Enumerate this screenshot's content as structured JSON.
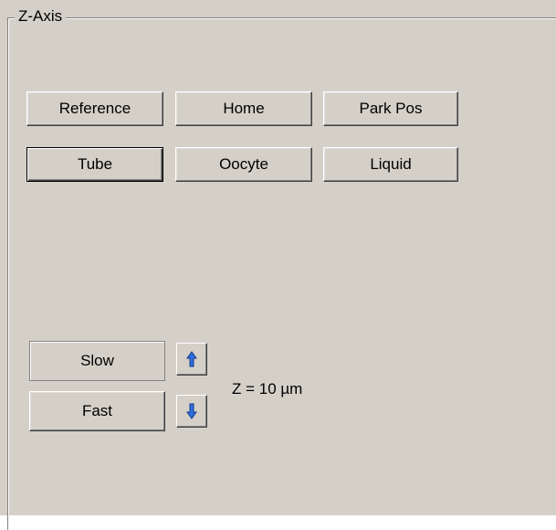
{
  "group": {
    "title": "Z-Axis"
  },
  "position_buttons": {
    "reference": "Reference",
    "home": "Home",
    "park_pos": "Park Pos",
    "tube": "Tube",
    "oocyte": "Oocyte",
    "liquid": "Liquid"
  },
  "speed": {
    "slow": "Slow",
    "fast": "Fast"
  },
  "icons": {
    "up": "arrow-up-icon",
    "down": "arrow-down-icon",
    "arrow_color": "#2f6ee0"
  },
  "z_readout": "Z = 10 µm"
}
